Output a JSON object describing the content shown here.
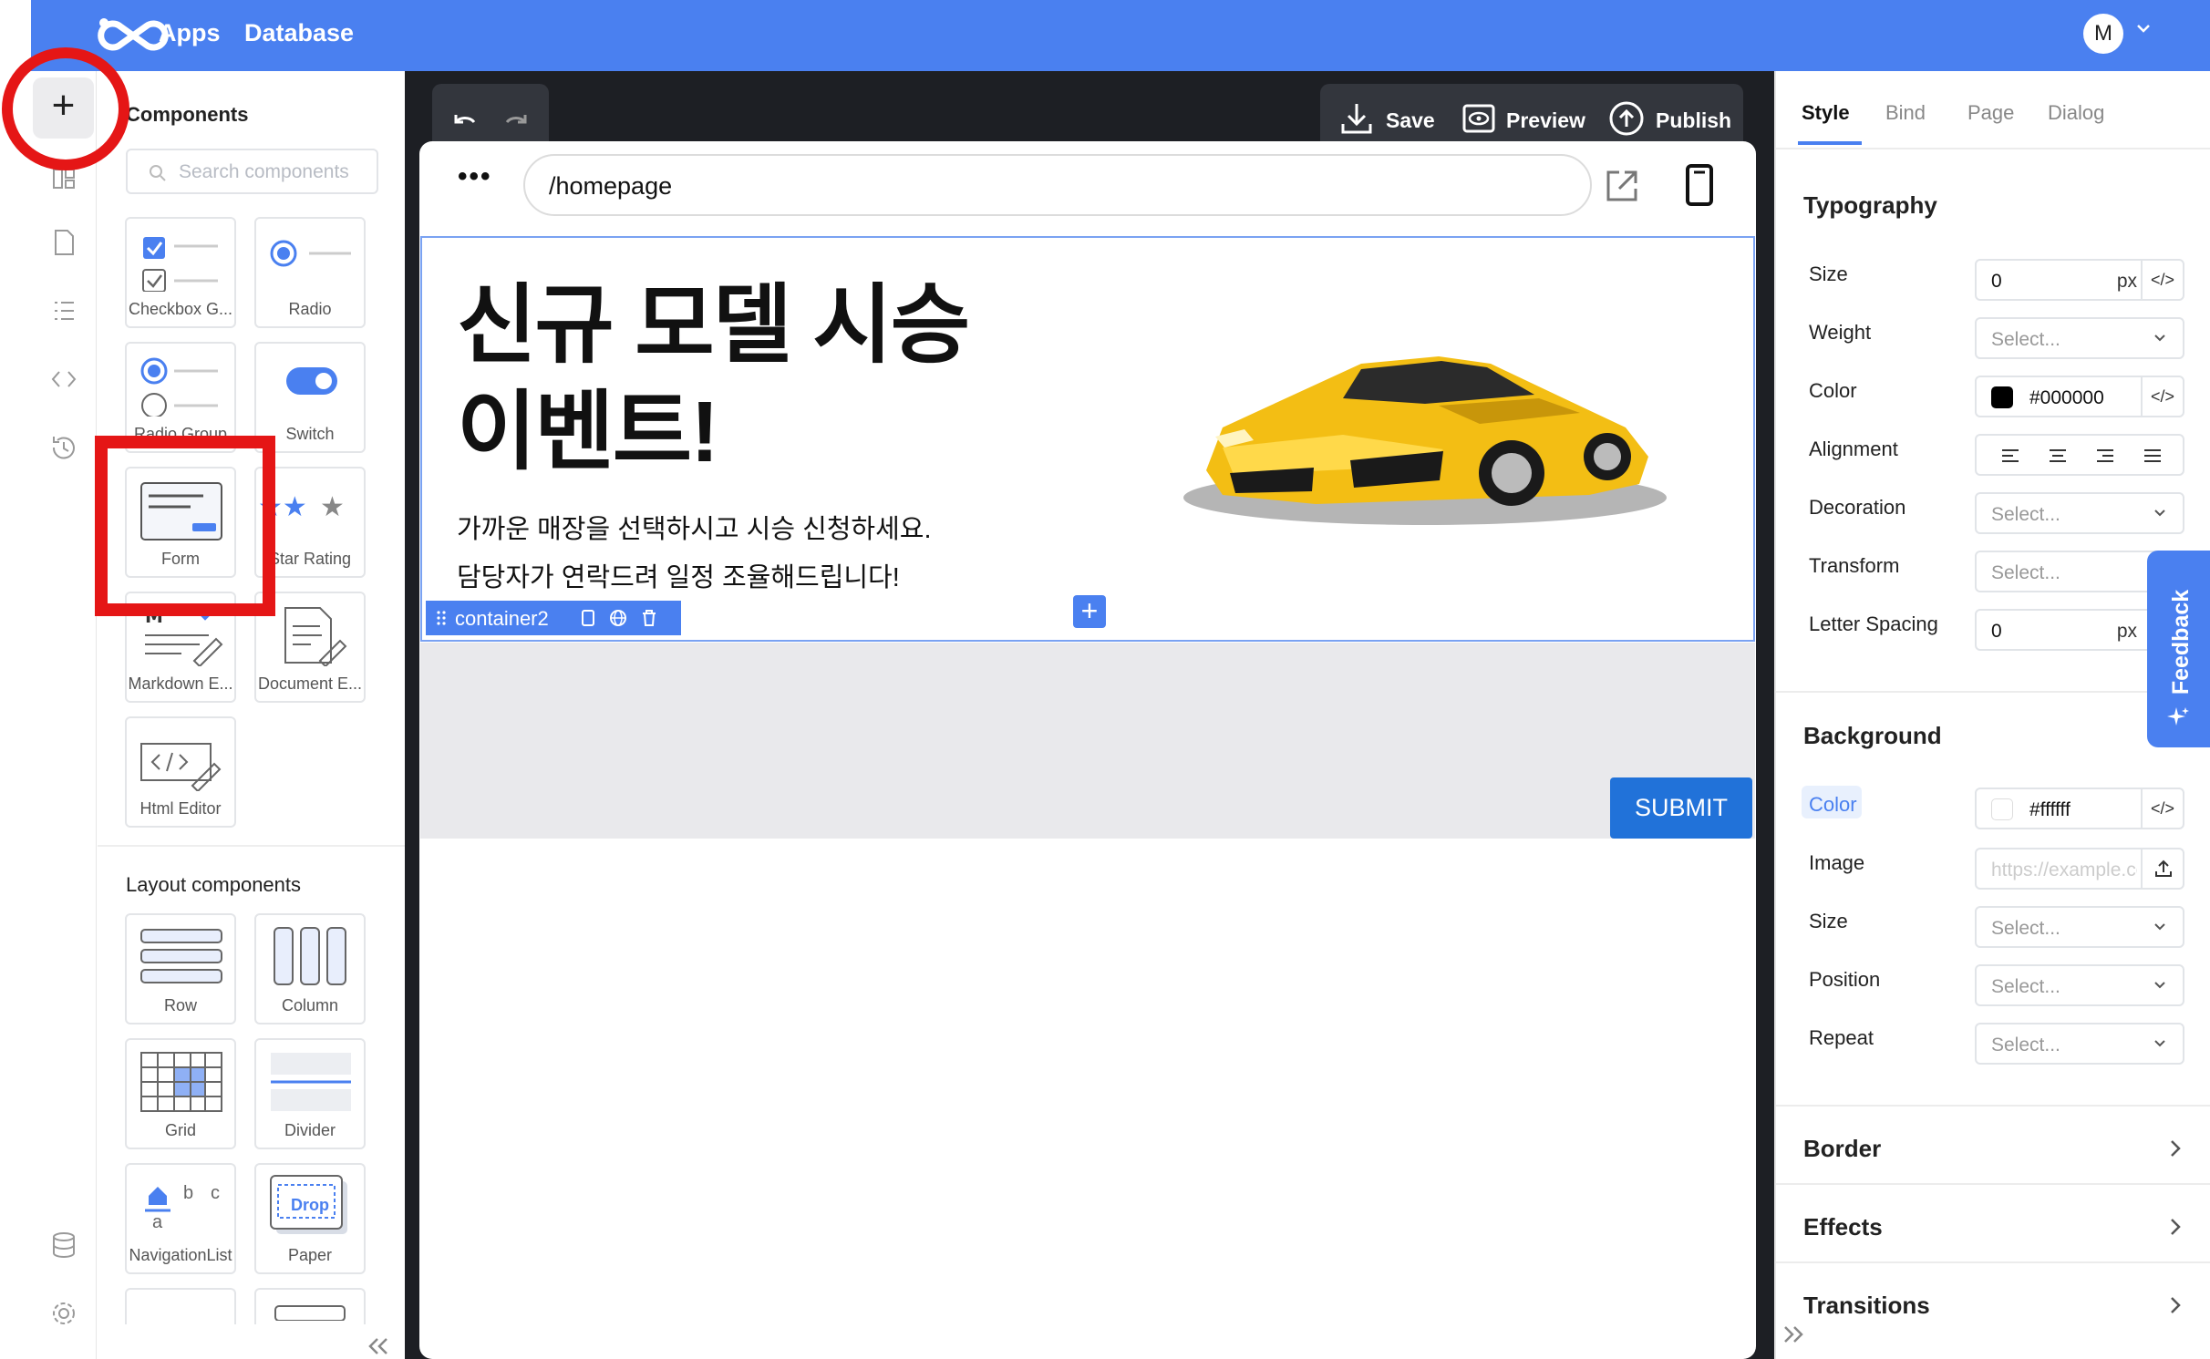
{
  "topbar": {
    "nav": [
      "Apps",
      "Database"
    ],
    "user_initial": "M",
    "accent": "#4a80f0"
  },
  "components": {
    "title": "Components",
    "search_placeholder": "Search components",
    "tiles": [
      "Checkbox G...",
      "Radio",
      "Radio Group",
      "Switch",
      "Form",
      "Star Rating",
      "Markdown E...",
      "Document E...",
      "Html Editor"
    ],
    "layout_title": "Layout components",
    "layout_tiles": [
      "Row",
      "Column",
      "Grid",
      "Divider",
      "NavigationList",
      "Paper"
    ],
    "nav_list_letters": [
      "b",
      "c",
      "a"
    ],
    "paper_label": "Drop"
  },
  "toolbar": {
    "save": "Save",
    "preview": "Preview",
    "publish": "Publish"
  },
  "canvas": {
    "url": "/homepage",
    "hero_title_lines": [
      "신규 모델 시승",
      "이벤트!"
    ],
    "hero_text_lines": [
      "가까운 매장을 선택하시고 시승 신청하세요.",
      "담당자가 연락드려 일정 조율해드립니다!"
    ],
    "container_tag": "container2",
    "submit_label": "SUBMIT"
  },
  "right_panel": {
    "tabs": [
      "Style",
      "Bind",
      "Page",
      "Dialog"
    ],
    "typography": {
      "title": "Typography",
      "size_label": "Size",
      "size_value": "0",
      "size_unit": "px",
      "weight_label": "Weight",
      "weight_value": "Select...",
      "color_label": "Color",
      "color_value": "#000000",
      "alignment_label": "Alignment",
      "decoration_label": "Decoration",
      "decoration_value": "Select...",
      "transform_label": "Transform",
      "transform_value": "Select...",
      "letter_spacing_label": "Letter Spacing",
      "letter_spacing_value": "0",
      "letter_spacing_unit": "px"
    },
    "background": {
      "title": "Background",
      "color_label": "Color",
      "color_value": "#ffffff",
      "image_label": "Image",
      "image_placeholder": "https://example.com",
      "size_label": "Size",
      "size_value": "Select...",
      "position_label": "Position",
      "position_value": "Select...",
      "repeat_label": "Repeat",
      "repeat_value": "Select..."
    },
    "sections": [
      "Border",
      "Effects",
      "Transitions"
    ],
    "feedback": "Feedback"
  }
}
